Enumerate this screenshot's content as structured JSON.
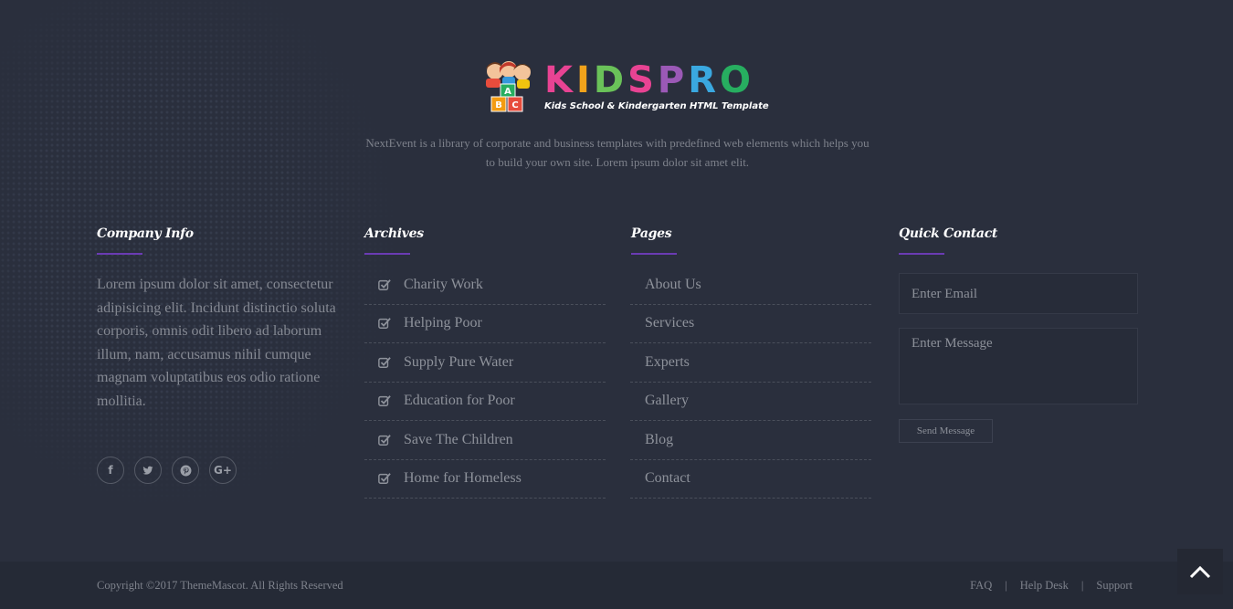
{
  "brand": {
    "name": "KIDSPRO",
    "letter_colors": [
      "#e84393",
      "#f2a31b",
      "#6ac259",
      "#e84393",
      "#9b59b6",
      "#3aa8e0",
      "#27ae60"
    ],
    "tagline": "Kids School & Kindergarten HTML Template",
    "blocks": [
      "A",
      "B",
      "C"
    ],
    "description": "NextEvent is a library of corporate and business templates with predefined web elements which helps you to build your own site. Lorem ipsum dolor sit amet elit."
  },
  "company_info": {
    "title": "Company Info",
    "text": "Lorem ipsum dolor sit amet, consectetur adipisicing elit. Incidunt distinctio soluta corporis, omnis odit libero ad laborum illum, nam, accusamus nihil cumque magnam voluptatibus eos odio ratione mollitia.",
    "socials": [
      {
        "name": "facebook-icon",
        "glyph": "f"
      },
      {
        "name": "twitter-icon",
        "glyph": "🐦"
      },
      {
        "name": "pinterest-icon",
        "glyph": "℗"
      },
      {
        "name": "google-plus-icon",
        "glyph": "G+"
      }
    ]
  },
  "archives": {
    "title": "Archives",
    "items": [
      "Charity Work",
      "Helping Poor",
      "Supply Pure Water",
      "Education for Poor",
      "Save The Children",
      "Home for Homeless"
    ]
  },
  "pages": {
    "title": "Pages",
    "items": [
      "About Us",
      "Services",
      "Experts",
      "Gallery",
      "Blog",
      "Contact"
    ]
  },
  "quick_contact": {
    "title": "Quick Contact",
    "email_placeholder": "Enter Email",
    "message_placeholder": "Enter Message",
    "send_label": "Send Message"
  },
  "footer_bottom": {
    "copyright": "Copyright ©2017 ThemeMascot. All Rights Reserved",
    "links": [
      "FAQ",
      "Help Desk",
      "Support"
    ],
    "separator": "|"
  },
  "colors": {
    "accent_line": "#6a3bb3",
    "background": "#2a2f3d",
    "bottom_bar": "#252a36"
  },
  "icons": {
    "scroll_top": "chevron-up-icon",
    "list_check": "check-square-icon"
  }
}
